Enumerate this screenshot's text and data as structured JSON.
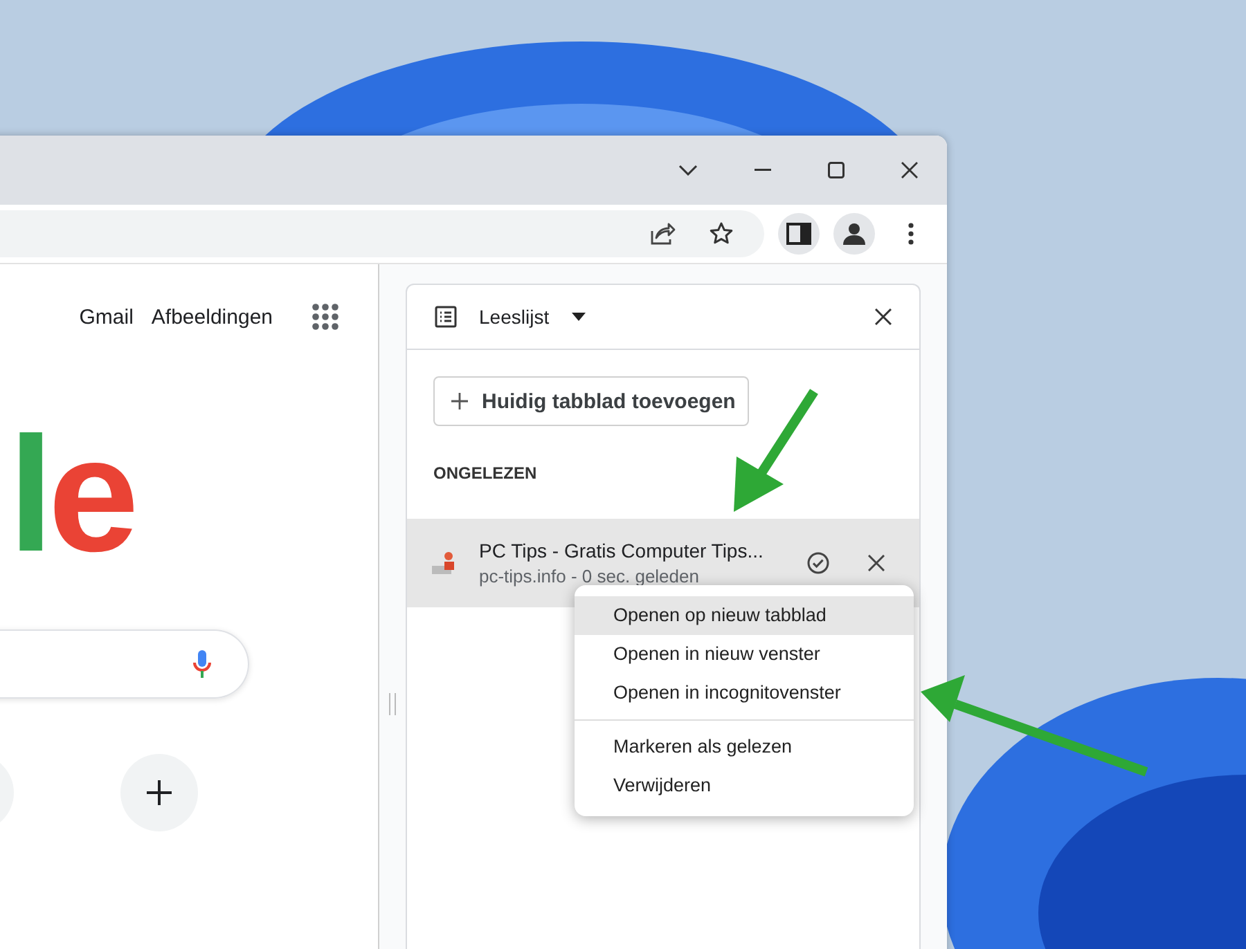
{
  "page": {
    "links": [
      "Gmail",
      "Afbeeldingen"
    ],
    "logo_text": "le"
  },
  "side_panel": {
    "title": "Leeslijst",
    "add_button": "Huidig tabblad toevoegen",
    "section_heading": "ONGELEZEN",
    "items": [
      {
        "title": "PC Tips - Gratis Computer Tips...",
        "subtitle": "pc-tips.info - 0 sec. geleden",
        "selected": true
      }
    ]
  },
  "context_menu": {
    "sections": [
      {
        "items": [
          {
            "label": "Openen op nieuw tabblad",
            "selected": true
          },
          {
            "label": "Openen in nieuw venster",
            "selected": false
          },
          {
            "label": "Openen in incognitovenster",
            "selected": false
          }
        ]
      },
      {
        "items": [
          {
            "label": "Markeren als gelezen",
            "selected": false
          },
          {
            "label": "Verwijderen",
            "selected": false
          }
        ]
      }
    ]
  }
}
